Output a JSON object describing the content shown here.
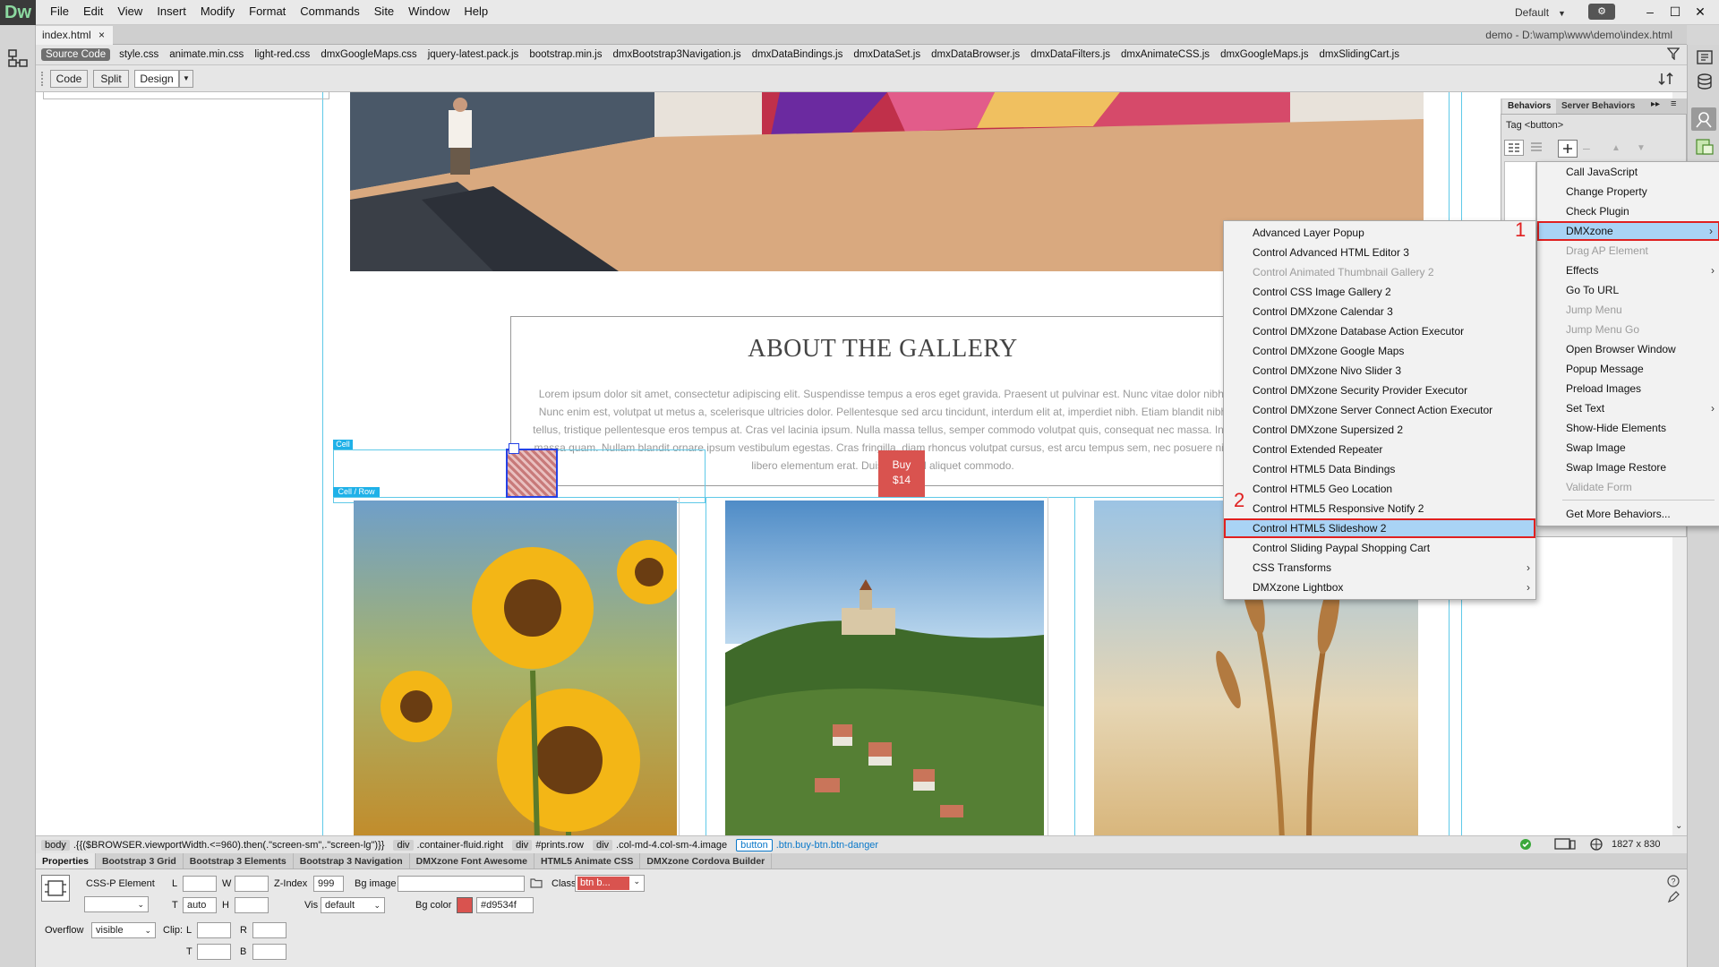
{
  "app": {
    "logo": "Dw",
    "menus": [
      "File",
      "Edit",
      "View",
      "Insert",
      "Modify",
      "Format",
      "Commands",
      "Site",
      "Window",
      "Help"
    ],
    "workspace": "Default",
    "sync_icon": "sync-icon"
  },
  "document": {
    "tab": "index.html",
    "close": "×",
    "path": "demo - D:\\wamp\\www\\demo\\index.html"
  },
  "related_files": [
    "Source Code",
    "style.css",
    "animate.min.css",
    "light-red.css",
    "dmxGoogleMaps.css",
    "jquery-latest.pack.js",
    "bootstrap.min.js",
    "dmxBootstrap3Navigation.js",
    "dmxDataBindings.js",
    "dmxDataSet.js",
    "dmxDataBrowser.js",
    "dmxDataFilters.js",
    "dmxAnimateCSS.js",
    "dmxGoogleMaps.js",
    "dmxSlidingCart.js"
  ],
  "view_buttons": {
    "code": "Code",
    "split": "Split",
    "design": "Design"
  },
  "canvas": {
    "heading": "ABOUT THE GALLERY",
    "paragraph": "Lorem ipsum dolor sit amet, consectetur adipiscing elit. Suspendisse tempus a eros eget gravida. Praesent ut pulvinar est. Nunc vitae dolor nibh. Nunc enim est, volutpat ut metus a, scelerisque ultricies dolor. Pellentesque sed arcu tincidunt, interdum elit at, imperdiet nibh. Etiam blandit nibh tellus, tristique pellentesque eros tempus at. Cras vel lacinia ipsum. Nulla massa tellus, semper commodo volutpat quis, consequat nec massa. In a massa quam. Nullam blandit ornare ipsum vestibulum egestas. Cras fringilla, diam rhoncus volutpat cursus, est arcu tempus sem, nec posuere nisl libero elementum erat. Duis euismod aliquet commodo.",
    "cell_label": "Cell",
    "cell_row_label": "Cell / Row",
    "buy": {
      "line1": "Buy",
      "line2": "$14"
    }
  },
  "status_bar": {
    "tags": [
      {
        "tag": "body",
        "label": ".{{($BROWSER.viewportWidth.<=960).then(.\"screen-sm\",.\"screen-lg\")}}"
      },
      {
        "tag": "div",
        "label": ".container-fluid.right"
      },
      {
        "tag": "div",
        "label": "#prints.row"
      },
      {
        "tag": "div",
        "label": ".col-md-4.col-sm-4.image"
      },
      {
        "tag": "button",
        "label": ".btn.buy-btn.btn-danger"
      }
    ],
    "size": "1827 x 830"
  },
  "properties": {
    "tabs": [
      "Properties",
      "Bootstrap 3 Grid",
      "Bootstrap 3 Elements",
      "Bootstrap 3 Navigation",
      "DMXzone Font Awesome",
      "HTML5 Animate CSS",
      "DMXzone Cordova Builder"
    ],
    "element_type": "CSS-P Element",
    "labels": {
      "l": "L",
      "w": "W",
      "zindex": "Z-Index",
      "bgimage": "Bg image",
      "class": "Class",
      "t": "T",
      "h": "H",
      "vis": "Vis",
      "bgcolor": "Bg color",
      "overflow": "Overflow",
      "clip": "Clip:",
      "clip_l": "L",
      "clip_r": "R",
      "clip_t": "T",
      "clip_b": "B"
    },
    "values": {
      "zindex": "999",
      "t": "auto",
      "vis": "default",
      "bgcolor": "#d9534f",
      "overflow": "visible",
      "class": "btn b..."
    }
  },
  "behaviors": {
    "tabs": [
      "Behaviors",
      "Server Behaviors"
    ],
    "tag": "Tag <button>",
    "menu": [
      {
        "label": "Call JavaScript",
        "disabled": false,
        "sub": false
      },
      {
        "label": "Change Property",
        "disabled": false,
        "sub": false
      },
      {
        "label": "Check Plugin",
        "disabled": false,
        "sub": false
      },
      {
        "label": "DMXzone",
        "disabled": false,
        "sub": true,
        "highlight": true
      },
      {
        "label": "Drag AP Element",
        "disabled": true,
        "sub": false
      },
      {
        "label": "Effects",
        "disabled": false,
        "sub": true
      },
      {
        "label": "Go To URL",
        "disabled": false,
        "sub": false
      },
      {
        "label": "Jump Menu",
        "disabled": true,
        "sub": false
      },
      {
        "label": "Jump Menu Go",
        "disabled": true,
        "sub": false
      },
      {
        "label": "Open Browser Window",
        "disabled": false,
        "sub": false
      },
      {
        "label": "Popup Message",
        "disabled": false,
        "sub": false
      },
      {
        "label": "Preload Images",
        "disabled": false,
        "sub": false
      },
      {
        "label": "Set Text",
        "disabled": false,
        "sub": true
      },
      {
        "label": "Show-Hide Elements",
        "disabled": false,
        "sub": false
      },
      {
        "label": "Swap Image",
        "disabled": false,
        "sub": false
      },
      {
        "label": "Swap Image Restore",
        "disabled": false,
        "sub": false
      },
      {
        "label": "Validate Form",
        "disabled": true,
        "sub": false
      },
      {
        "label": "Get More Behaviors...",
        "disabled": false,
        "sub": false
      }
    ]
  },
  "dmxzone_menu": [
    {
      "label": "Advanced Layer Popup",
      "disabled": false,
      "sub": false
    },
    {
      "label": "Control Advanced HTML Editor 3",
      "disabled": false,
      "sub": false
    },
    {
      "label": "Control Animated Thumbnail Gallery 2",
      "disabled": true,
      "sub": false
    },
    {
      "label": "Control CSS Image Gallery 2",
      "disabled": false,
      "sub": false
    },
    {
      "label": "Control DMXzone Calendar 3",
      "disabled": false,
      "sub": false
    },
    {
      "label": "Control DMXzone Database Action Executor",
      "disabled": false,
      "sub": false
    },
    {
      "label": "Control DMXzone Google Maps",
      "disabled": false,
      "sub": false
    },
    {
      "label": "Control DMXzone Nivo Slider 3",
      "disabled": false,
      "sub": false
    },
    {
      "label": "Control DMXzone Security Provider Executor",
      "disabled": false,
      "sub": false
    },
    {
      "label": "Control DMXzone Server Connect Action Executor",
      "disabled": false,
      "sub": false
    },
    {
      "label": "Control DMXzone Supersized 2",
      "disabled": false,
      "sub": false
    },
    {
      "label": "Control Extended Repeater",
      "disabled": false,
      "sub": false
    },
    {
      "label": "Control HTML5 Data Bindings",
      "disabled": false,
      "sub": false
    },
    {
      "label": "Control HTML5 Geo Location",
      "disabled": false,
      "sub": false
    },
    {
      "label": "Control HTML5 Responsive Notify 2",
      "disabled": false,
      "sub": false
    },
    {
      "label": "Control HTML5 Slideshow 2",
      "disabled": false,
      "sub": false,
      "highlight": true
    },
    {
      "label": "Control Sliding Paypal Shopping Cart",
      "disabled": false,
      "sub": false
    },
    {
      "label": "CSS Transforms",
      "disabled": false,
      "sub": true
    },
    {
      "label": "DMXzone Lightbox",
      "disabled": false,
      "sub": true
    }
  ],
  "annotations": {
    "step1": "1",
    "step2": "2"
  },
  "colors": {
    "accent": "#0a78c9",
    "highlight": "#a9d3f5",
    "annotation": "#e02020",
    "btn_danger": "#d9534f"
  }
}
